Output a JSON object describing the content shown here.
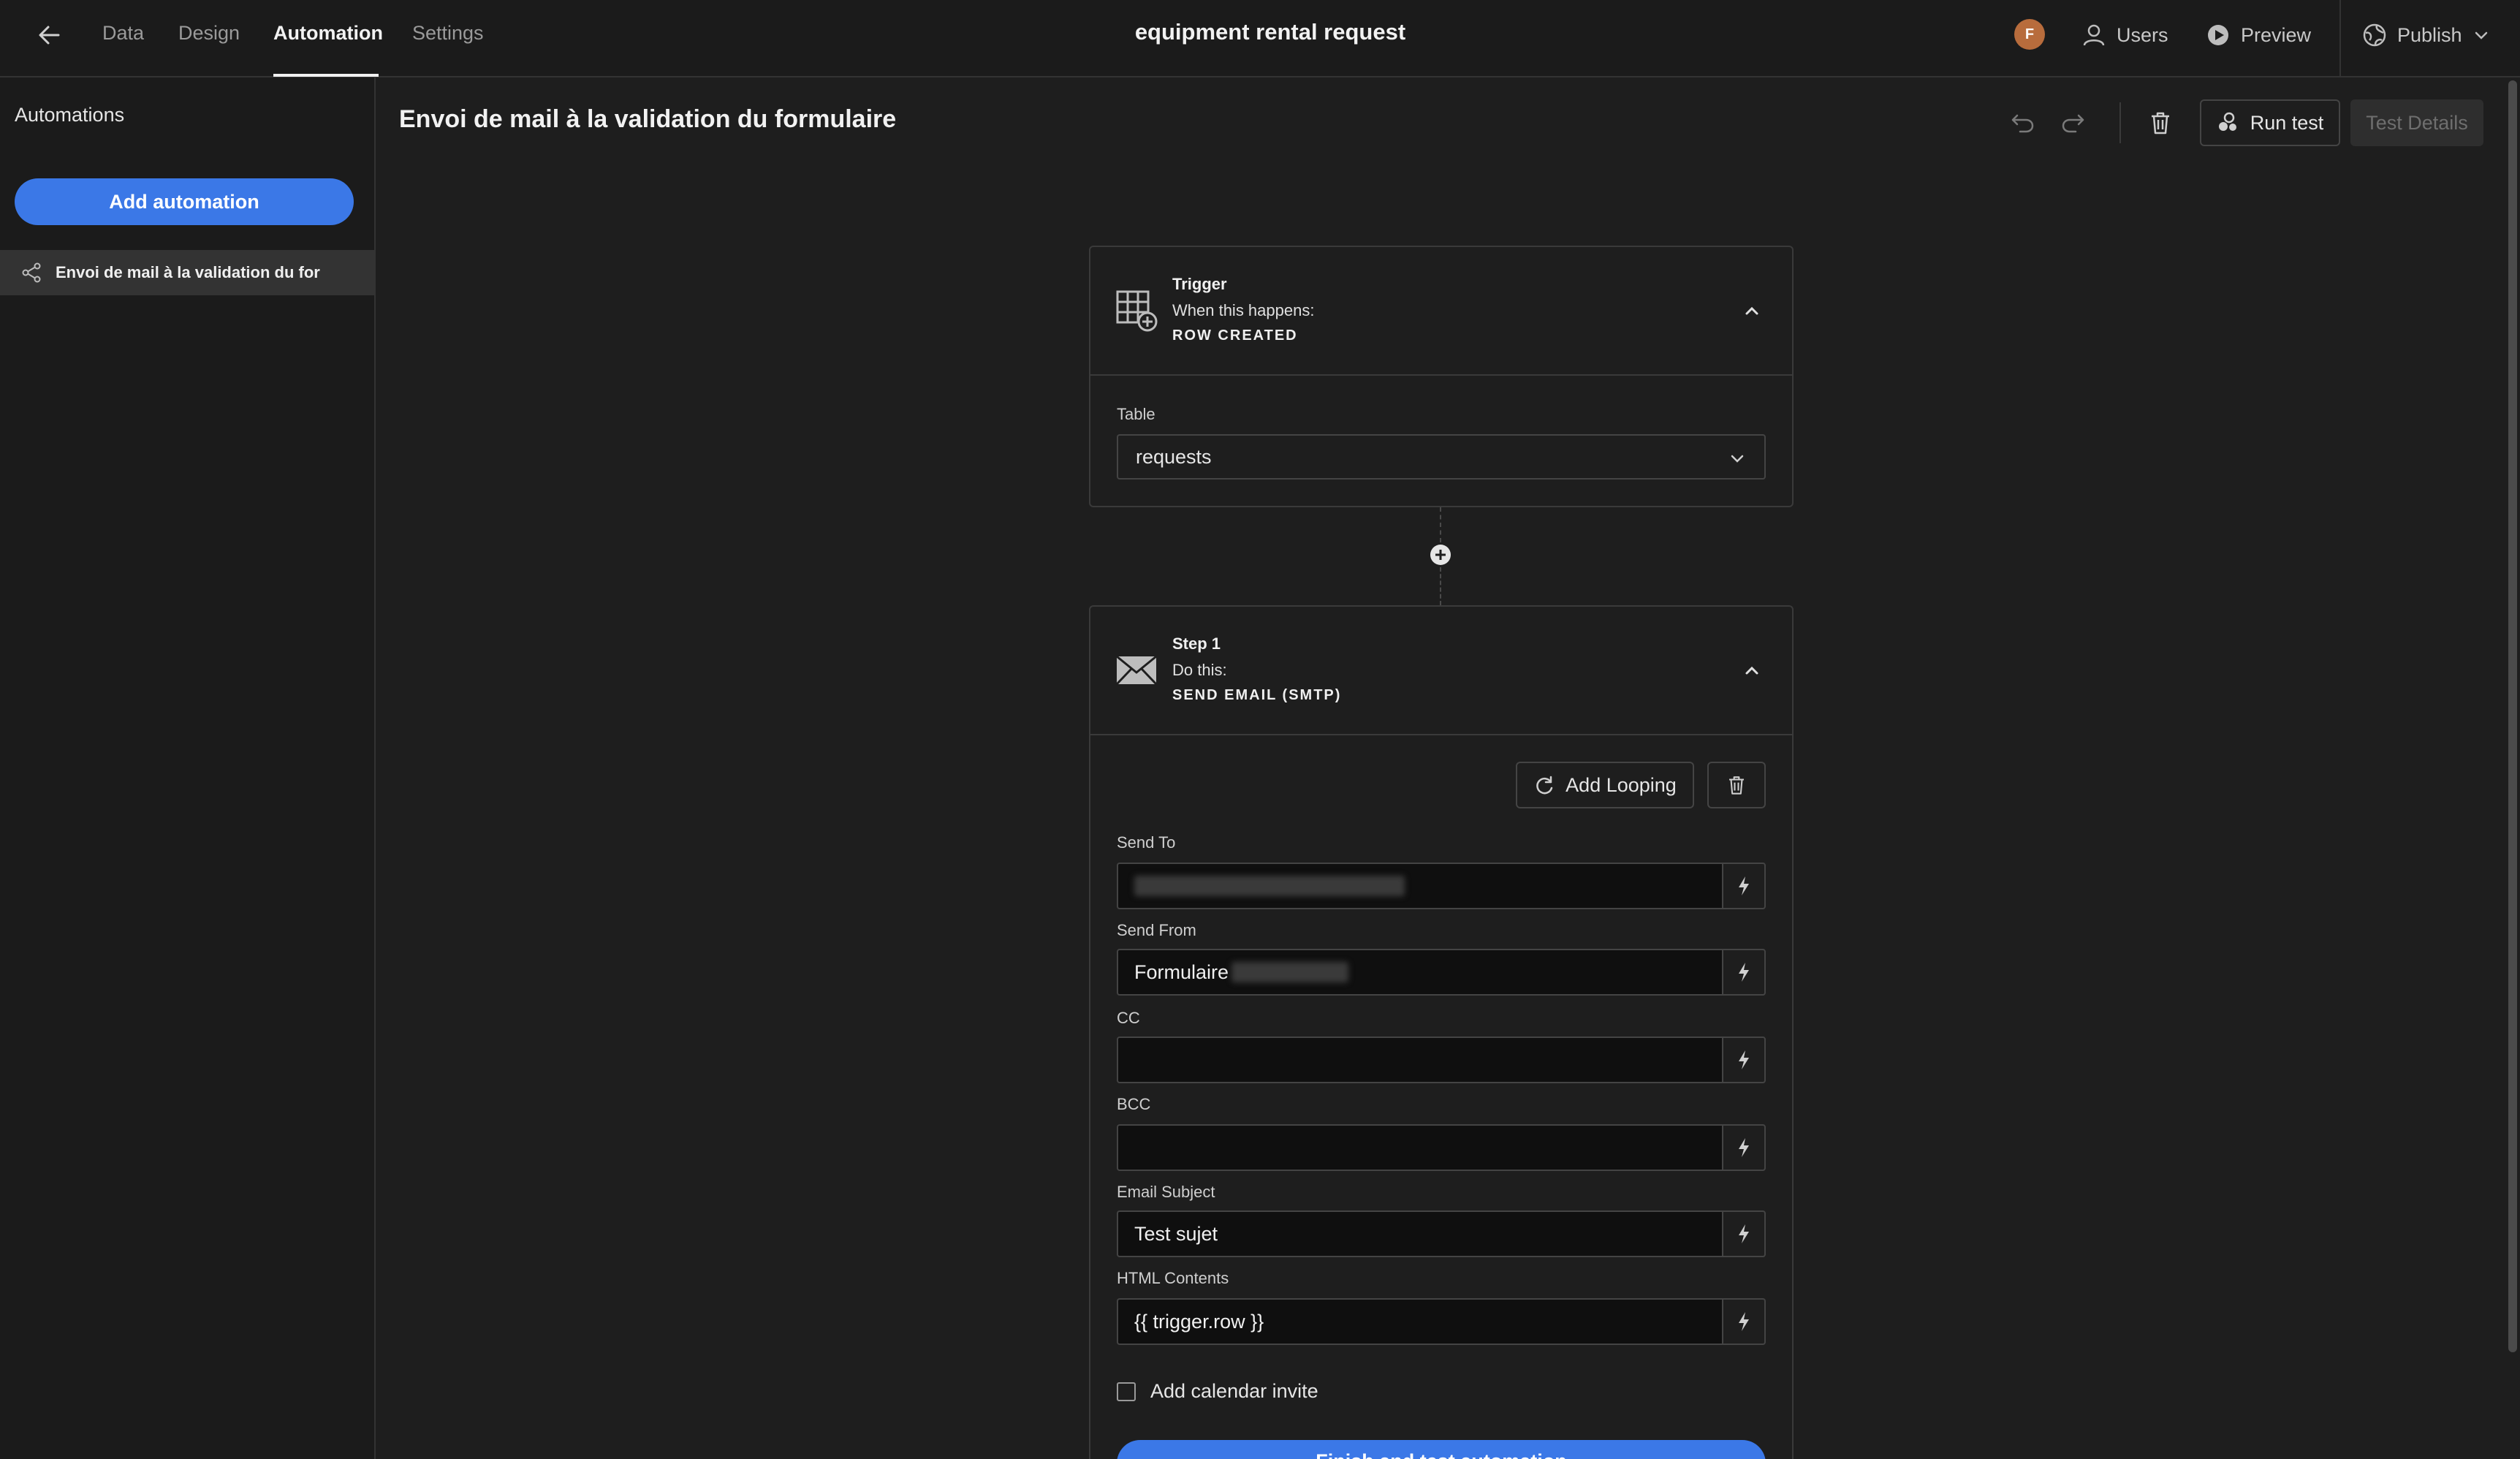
{
  "topbar": {
    "tabs": [
      {
        "label": "Data"
      },
      {
        "label": "Design"
      },
      {
        "label": "Automation"
      },
      {
        "label": "Settings"
      }
    ],
    "app_title": "equipment rental request",
    "avatar_initial": "F",
    "users_label": "Users",
    "preview_label": "Preview",
    "publish_label": "Publish"
  },
  "sidebar": {
    "title": "Automations",
    "add_button": "Add automation",
    "items": [
      {
        "label": "Envoi de mail à la validation du for"
      }
    ]
  },
  "main": {
    "title": "Envoi de mail à la validation du formulaire",
    "run_test_label": "Run test",
    "test_details_label": "Test Details"
  },
  "trigger": {
    "kind": "Trigger",
    "when": "When this happens:",
    "event": "ROW CREATED",
    "table_label": "Table",
    "table_value": "requests"
  },
  "step1": {
    "kind": "Step 1",
    "doThis": "Do this:",
    "action": "SEND EMAIL (SMTP)",
    "add_looping_label": "Add Looping",
    "fields": {
      "send_to": {
        "label": "Send To",
        "value": ""
      },
      "send_from": {
        "label": "Send From",
        "value": "Formulaire"
      },
      "cc": {
        "label": "CC",
        "value": ""
      },
      "bcc": {
        "label": "BCC",
        "value": ""
      },
      "subject": {
        "label": "Email Subject",
        "value": "Test sujet"
      },
      "html": {
        "label": "HTML Contents",
        "value": "{{ trigger.row }}"
      }
    },
    "calendar_label": "Add calendar invite",
    "finish_label": "Finish and test automation"
  },
  "colors": {
    "accent": "#3b78e7",
    "background": "#1e1e1e",
    "avatar": "#b86c3c"
  }
}
